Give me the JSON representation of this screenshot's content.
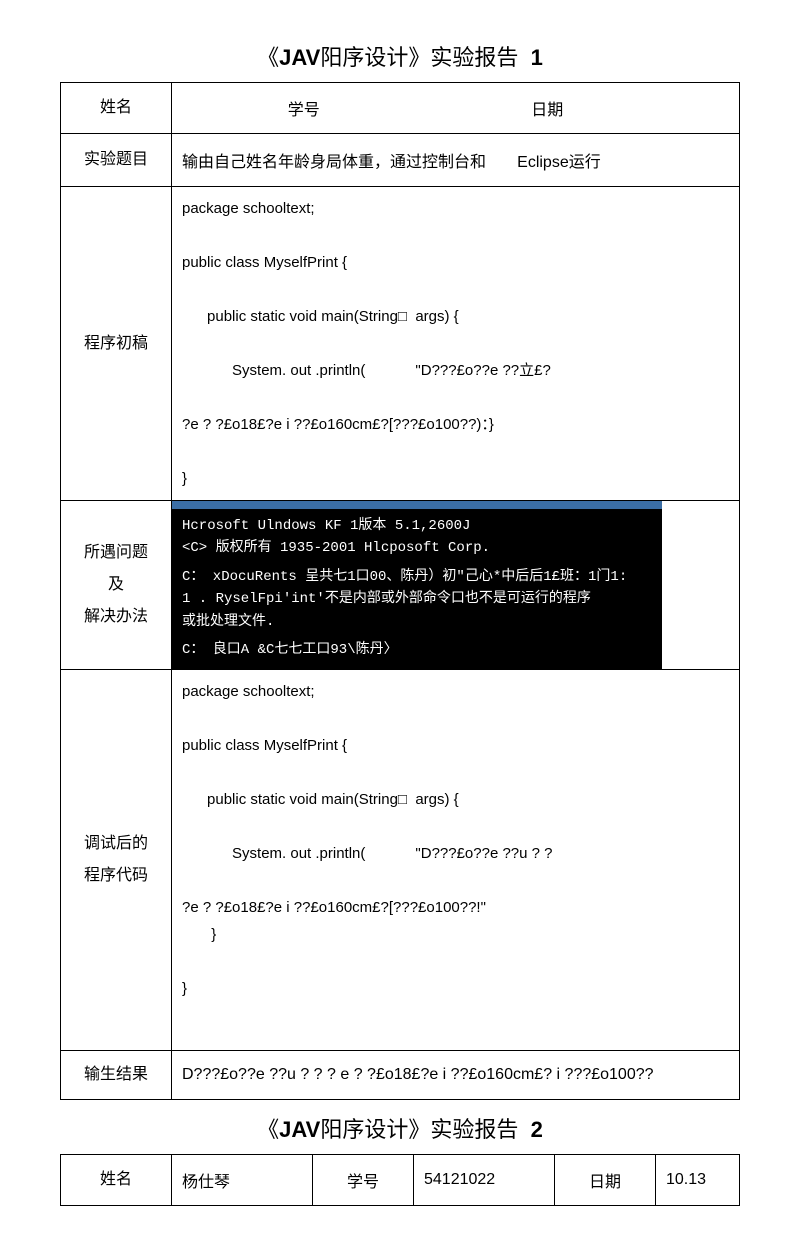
{
  "report1": {
    "title_prefix": "《",
    "title_bold": "JAV",
    "title_rest": "阳序设计》实验报告",
    "title_num": "1",
    "header": {
      "name": "姓名",
      "id": "学号",
      "date": "日期"
    },
    "topic_label": "实验题目",
    "topic_text1": "输由自己姓名年龄身局体重，通过控制台和",
    "topic_text2": "Eclipse运行",
    "draft_label": "程序初稿",
    "draft_code": "package schooltext;\n\npublic class MyselfPrint {\n\n      public static void main(String□  args) {\n\n            System. out .println(            \"D???£o??e ??立£?\n\n?e ? ?£o18£?e i ??£o160cm£?[???£o100??)：}\n\n}",
    "problem_label1": "所遇问题",
    "problem_label2": "及",
    "problem_label3": "解决办法",
    "terminal_line1": "Hcrosoft Ulndows KF 1版本  5.1,2600J",
    "terminal_line2": "<C> 版权所有  1935-2001 Hlcposoft Corp.",
    "terminal_line3": "C： xDocuRents  呈共七1口00、陈丹）初\"己心*中后后1£班：1门1:",
    "terminal_line4": "1        . RyselFpi'int'不是内部或外部命令口也不是可运行的程序",
    "terminal_line5": "或批处理文件.",
    "terminal_line6": "C：            良口A &C七七工口93\\陈丹〉",
    "debug_label1": "调试后的",
    "debug_label2": "程序代码",
    "debug_code": "package schooltext;\n\npublic class MyselfPrint {\n\n      public static void main(String□  args) {\n\n            System. out .println(            \"D???£o??e ??u ? ?\n\n?e ? ?£o18£?e i ??£o160cm£?[???£o100??!\"\n       }\n\n}",
    "result_label": "输生结果",
    "result_text": "D???£o??e ??u ? ? ? e ? ?£o18£?e i ??£o160cm£? i ???£o100??"
  },
  "report2": {
    "title_prefix": "《",
    "title_bold": "JAV",
    "title_rest": "阳序设计》实验报告",
    "title_num": "2",
    "header": {
      "name_label": "姓名",
      "name_val": "杨仕琴",
      "id_label": "学号",
      "id_val": "54121022",
      "date_label": "日期",
      "date_val": "10.13"
    }
  }
}
